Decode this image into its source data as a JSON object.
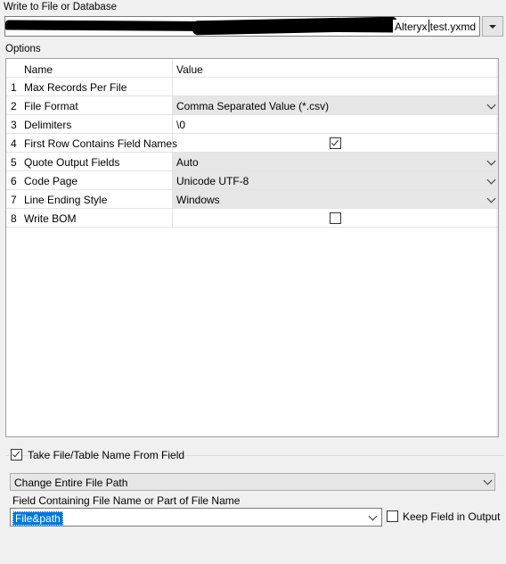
{
  "header": {
    "title": "Write to File or Database",
    "path_value": "Alteryx test.yxmd",
    "path_visible_a": "Alteryx",
    "path_visible_b": "test.yxmd"
  },
  "options": {
    "label": "Options",
    "columns": {
      "name": "Name",
      "value": "Value"
    },
    "rows": [
      {
        "num": "1",
        "name": "Max Records Per File",
        "value": "",
        "kind": "text"
      },
      {
        "num": "2",
        "name": "File Format",
        "value": "Comma Separated Value (*.csv)",
        "kind": "dropdown"
      },
      {
        "num": "3",
        "name": "Delimiters",
        "value": "\\0",
        "kind": "text"
      },
      {
        "num": "4",
        "name": "First Row Contains Field Names",
        "value": "",
        "kind": "checkbox",
        "checked": true
      },
      {
        "num": "5",
        "name": "Quote Output Fields",
        "value": "Auto",
        "kind": "dropdown"
      },
      {
        "num": "6",
        "name": "Code Page",
        "value": "Unicode UTF-8",
        "kind": "dropdown"
      },
      {
        "num": "7",
        "name": "Line Ending Style",
        "value": "Windows",
        "kind": "dropdown"
      },
      {
        "num": "8",
        "name": "Write BOM",
        "value": "",
        "kind": "checkbox",
        "checked": false
      }
    ]
  },
  "bottom": {
    "take_from_field_label": "Take File/Table Name From Field",
    "take_from_field_checked": true,
    "mode_value": "Change Entire File Path",
    "field_label": "Field Containing File Name or Part of File Name",
    "field_value": "File&path",
    "keep_field_label": "Keep Field in Output",
    "keep_field_checked": false
  }
}
